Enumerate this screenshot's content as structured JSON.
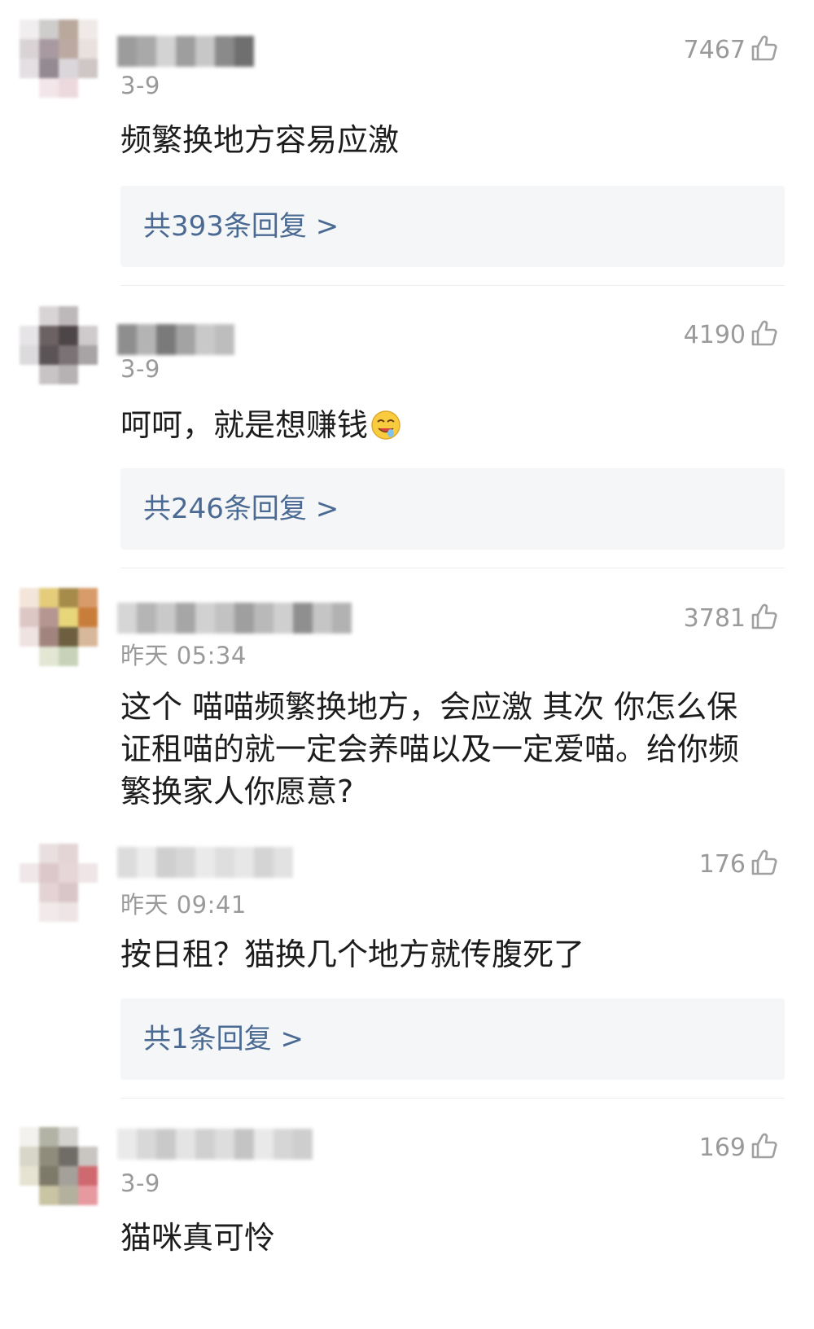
{
  "comments": [
    {
      "time": "3-9",
      "likes": "7467",
      "text": "频繁换地方容易应激",
      "reply_label": "共393条回复 >"
    },
    {
      "time": "3-9",
      "likes": "4190",
      "text": "呵呵，就是想赚钱",
      "emoji": "drooling-face-emoji",
      "reply_label": "共246条回复 >"
    },
    {
      "time": "昨天 05:34",
      "likes": "3781",
      "text": "这个 喵喵频繁换地方，会应激  其次 你怎么保证租喵的就一定会养喵以及一定爱喵。给你频繁换家人你愿意?"
    },
    {
      "time": "昨天 09:41",
      "likes": "176",
      "text": "按日租？猫换几个地方就传腹死了",
      "reply_label": "共1条回复 >"
    },
    {
      "time": "3-9",
      "likes": "169",
      "text": "猫咪真可怜"
    }
  ],
  "icons": {
    "like": "thumbs-up-icon"
  },
  "colors": {
    "reply_link": "#4a6a93",
    "meta_gray": "#9a9a9a",
    "reply_bg": "#f5f6f8"
  }
}
